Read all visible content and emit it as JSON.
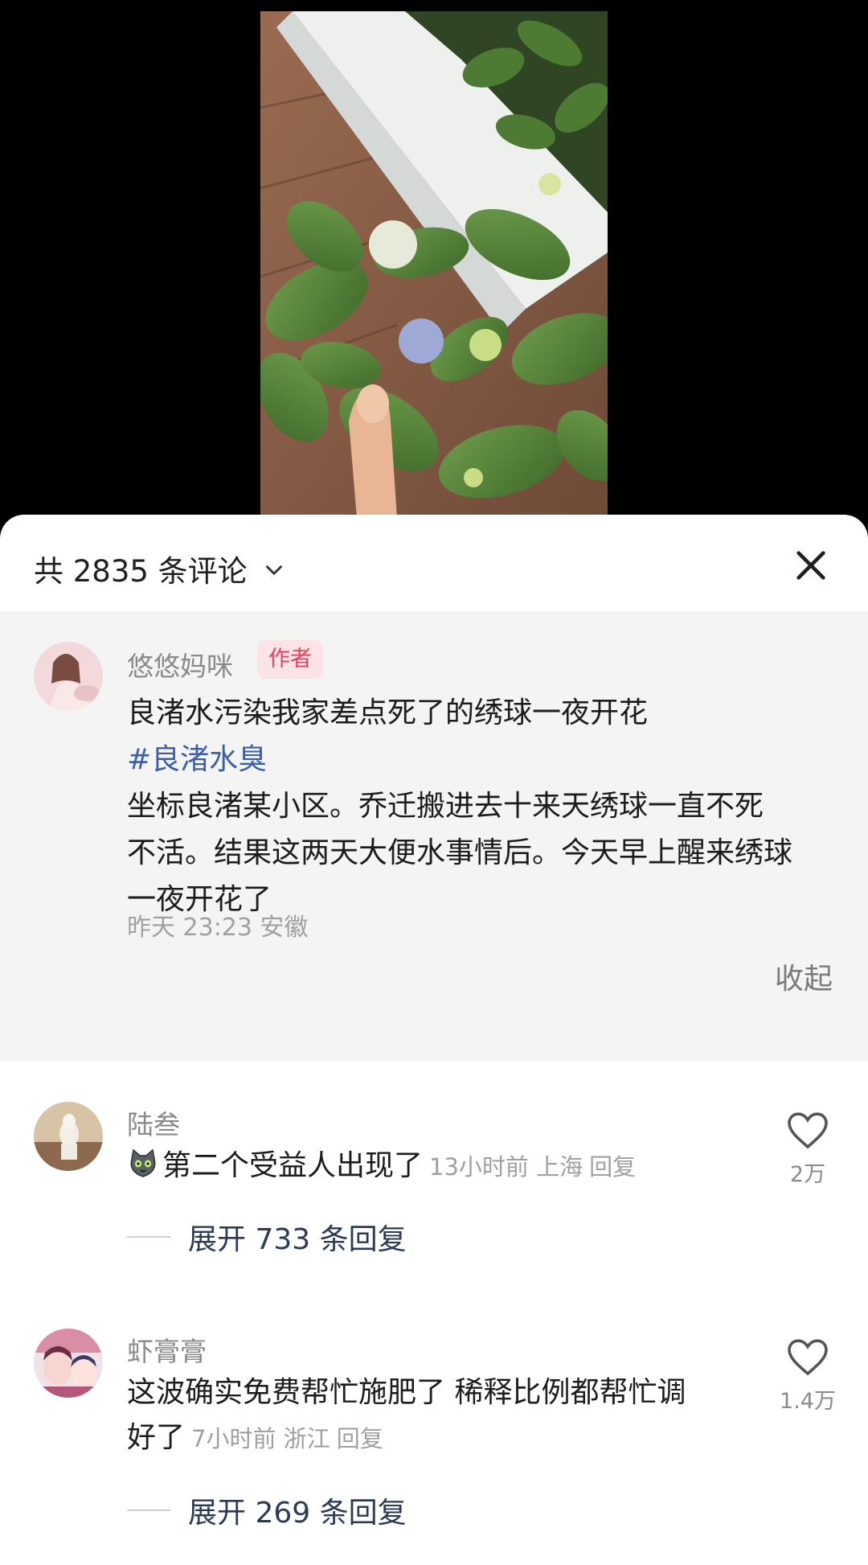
{
  "header": {
    "comment_count_label": "共 2835 条评论"
  },
  "pinned_comment": {
    "username": "悠悠妈咪",
    "badge": "作者",
    "lines": [
      "良渚水污染我家差点死了的绣球一夜开花",
      "#良渚水臭",
      "坐标良渚某小区。乔迁搬进去十来天绣球一直不死",
      "不活。结果这两天大便水事情后。今天早上醒来绣球",
      "一夜开花了"
    ],
    "meta": "昨天 23:23 安徽",
    "collapse_label": "收起"
  },
  "comments": [
    {
      "username": "陆叁",
      "text": "第二个受益人出现了",
      "time_location": "13小时前 上海",
      "reply_label": "回复",
      "likes": "2万",
      "expand_label": "展开 733 条回复"
    },
    {
      "username": "虾膏膏",
      "text_line1": "这波确实免费帮忙施肥了 稀释比例都帮忙调",
      "text_line2": "好了",
      "time_location": "7小时前 浙江",
      "reply_label": "回复",
      "likes": "1.4万",
      "expand_label": "展开 269 条回复"
    }
  ],
  "colors": {
    "hashtag": "#3d5ea8",
    "author_badge_bg": "#fbe3e6",
    "author_badge_text": "#e9415f",
    "pinned_bg": "#f4f4f4"
  },
  "icons": [
    "chevron-down-icon",
    "close-icon",
    "heart-icon",
    "cat-emoji"
  ]
}
